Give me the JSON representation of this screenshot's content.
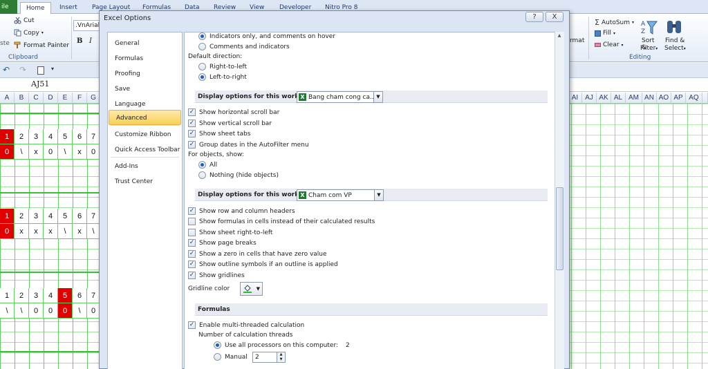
{
  "ribbon": {
    "tabs": [
      "ile",
      "Home",
      "Insert",
      "Page Layout",
      "Formulas",
      "Data",
      "Review",
      "View",
      "Developer",
      "Nitro Pro 8"
    ],
    "clipboard": {
      "cut": "Cut",
      "copy": "Copy",
      "format_painter": "Format Painter",
      "group": "Clipboard",
      "paste_partial": "ste"
    },
    "font_name": ".VnArial",
    "bold": "B",
    "italic": "I",
    "format_partial": "rmat",
    "editing": {
      "autosum": "AutoSum",
      "fill": "Fill",
      "clear": "Clear",
      "sort_filter": "Sort &",
      "sort_filter2": "Filter",
      "find_select": "Find &",
      "find_select2": "Select",
      "group": "Editing"
    }
  },
  "name_box": "AJ51",
  "sheet": {
    "left_columns": [
      "A",
      "B",
      "C",
      "D",
      "E",
      "F",
      "G"
    ],
    "right_columns": [
      "AI",
      "AJ",
      "AK",
      "AL",
      "AM",
      "AN",
      "AO",
      "AP",
      "AQ"
    ],
    "block1": {
      "row1": [
        "1",
        "2",
        "3",
        "4",
        "5",
        "6",
        "7"
      ],
      "row2": [
        "0",
        "\\",
        "x",
        "0",
        "\\",
        "x",
        "0"
      ],
      "red_col": 0
    },
    "block2": {
      "row1": [
        "1",
        "2",
        "3",
        "4",
        "5",
        "6",
        "7"
      ],
      "row2": [
        "0",
        "x",
        "x",
        "x",
        "\\",
        "x",
        "\\"
      ],
      "red_col": 0
    },
    "block3": {
      "row1": [
        "1",
        "2",
        "3",
        "4",
        "5",
        "6",
        "7"
      ],
      "row2": [
        "\\",
        "\\",
        "0",
        "0",
        "0",
        "\\",
        "0"
      ],
      "red_col": 4
    }
  },
  "dialog": {
    "title": "Excel Options",
    "help": "?",
    "close": "X",
    "nav": [
      "General",
      "Formulas",
      "Proofing",
      "Save",
      "Language",
      "Advanced",
      "Customize Ribbon",
      "Quick Access Toolbar",
      "Add-Ins",
      "Trust Center"
    ],
    "active_nav": "Advanced",
    "comments": {
      "indicators_hover": "Indicators only, and comments on hover",
      "comments_indicators": "Comments and indicators"
    },
    "default_direction": {
      "label": "Default direction:",
      "rtl": "Right-to-left",
      "ltr": "Left-to-right"
    },
    "workbook": {
      "header": "Display options for this workbook:",
      "combo": "Bang cham cong ca...",
      "options": [
        {
          "label": "Show horizontal scroll bar",
          "checked": true
        },
        {
          "label": "Show vertical scroll bar",
          "checked": true
        },
        {
          "label": "Show sheet tabs",
          "checked": true
        },
        {
          "label": "Group dates in the AutoFilter menu",
          "checked": true
        }
      ],
      "objects_label": "For objects, show:",
      "objects_all": "All",
      "objects_nothing": "Nothing (hide objects)"
    },
    "worksheet": {
      "header": "Display options for this worksheet:",
      "combo": "Cham com VP",
      "options": [
        {
          "label": "Show row and column headers",
          "checked": true
        },
        {
          "label": "Show formulas in cells instead of their calculated results",
          "checked": false
        },
        {
          "label": "Show sheet right-to-left",
          "checked": false
        },
        {
          "label": "Show page breaks",
          "checked": true
        },
        {
          "label": "Show a zero in cells that have zero value",
          "checked": true
        },
        {
          "label": "Show outline symbols if an outline is applied",
          "checked": true
        },
        {
          "label": "Show gridlines",
          "checked": true
        }
      ],
      "gridline_color_label": "Gridline color"
    },
    "formulas": {
      "header": "Formulas",
      "multithreaded": "Enable multi-threaded calculation",
      "threads_label": "Number of calculation threads",
      "use_all": "Use all processors on this computer:",
      "processors": "2",
      "manual": "Manual",
      "manual_value": "2"
    }
  },
  "colors": {
    "accent": "#f9cf59",
    "red_cell": "#e00000",
    "gridline": "#5fcf5f"
  }
}
